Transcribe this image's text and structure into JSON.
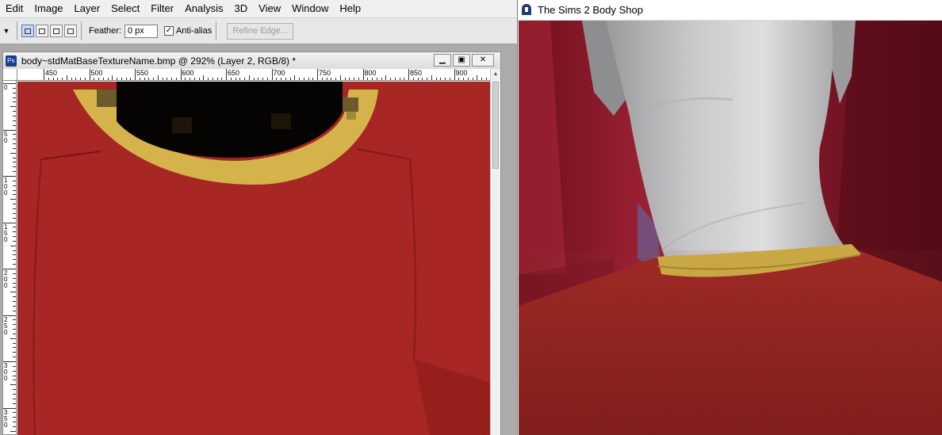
{
  "photoshop": {
    "menu": [
      "Edit",
      "Image",
      "Layer",
      "Select",
      "Filter",
      "Analysis",
      "3D",
      "View",
      "Window",
      "Help"
    ],
    "options": {
      "feather_label": "Feather:",
      "feather_value": "0 px",
      "antialias_label": "Anti-alias",
      "antialias_checked": "✓",
      "refine_label": "Refine Edge..."
    },
    "document": {
      "app_badge": "Ps",
      "title": "body~stdMatBaseTextureName.bmp @ 292% (Layer 2, RGB/8) *",
      "ruler_x": [
        "450",
        "500",
        "550",
        "600",
        "650",
        "700",
        "750",
        "800",
        "850",
        "900"
      ],
      "ruler_y": [
        "0",
        "50",
        "100",
        "150",
        "200",
        "250",
        "300",
        "350"
      ]
    },
    "colors": {
      "shirt": "#a8231f",
      "collar": "#d4b44a",
      "chrome": "#ababab"
    }
  },
  "bodyshop": {
    "title": "The Sims 2 Body Shop"
  }
}
